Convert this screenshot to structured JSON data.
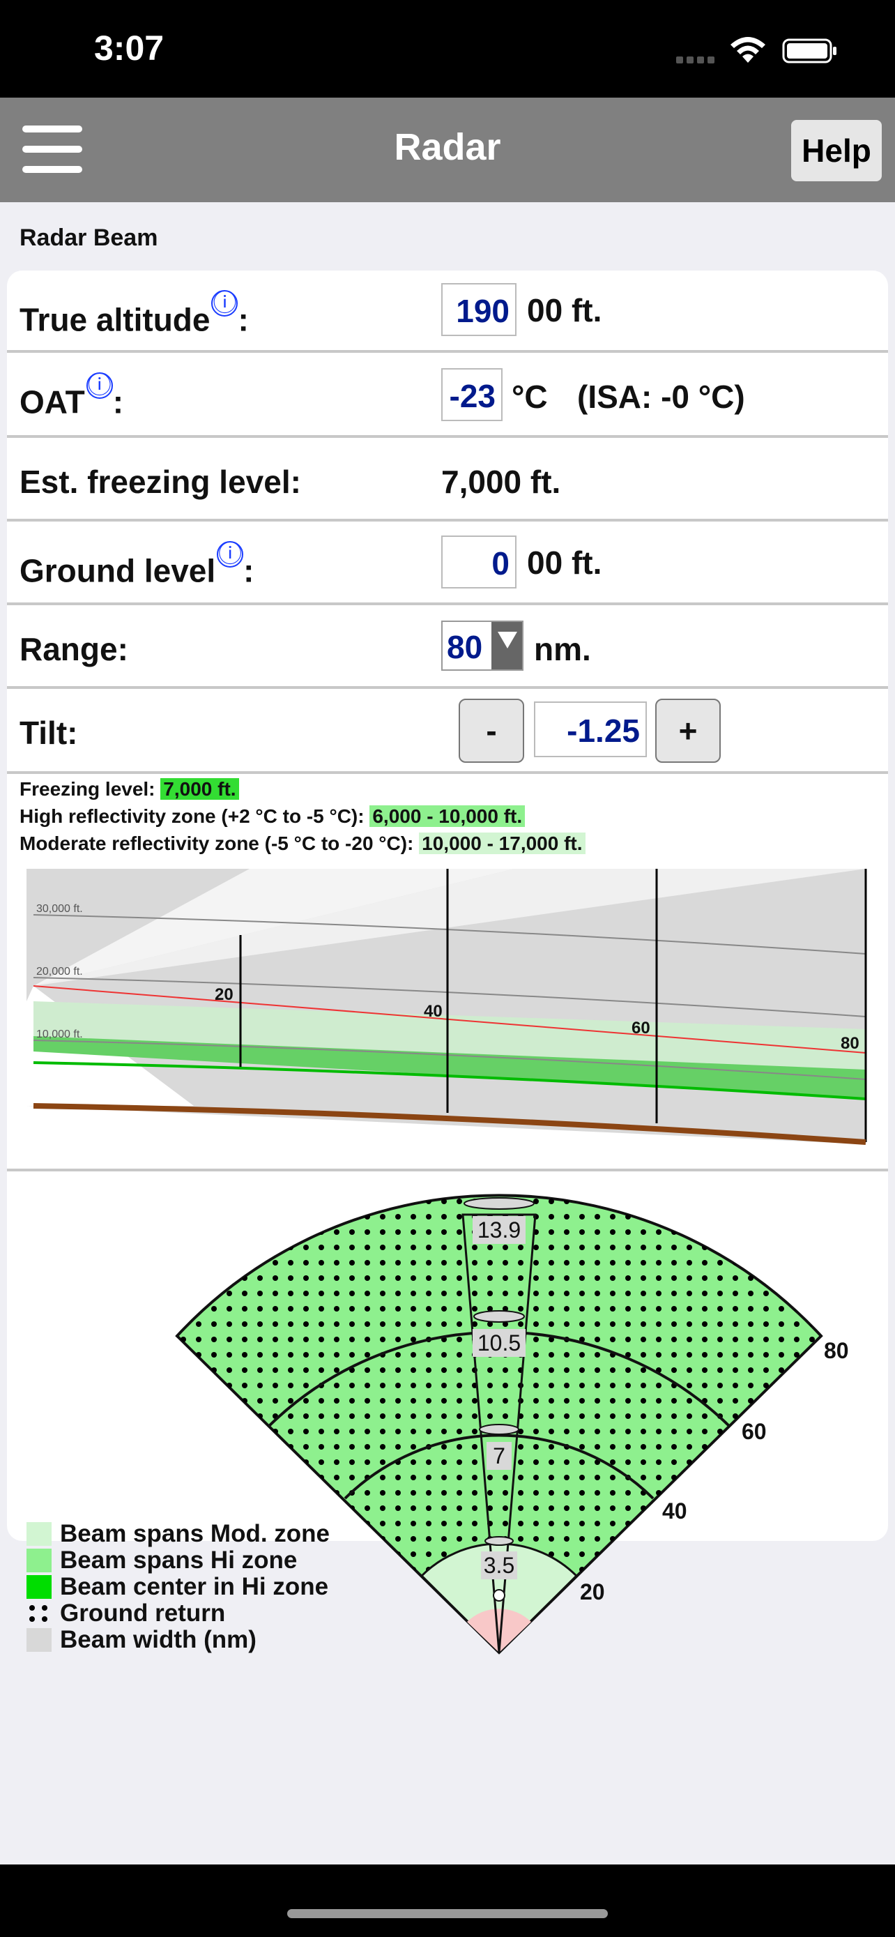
{
  "status": {
    "time": "3:07"
  },
  "nav": {
    "title": "Radar",
    "help_label": "Help"
  },
  "section": {
    "label": "Radar Beam"
  },
  "fields": {
    "true_altitude": {
      "label": "True altitude",
      "value": "190",
      "unit": "00 ft."
    },
    "oat": {
      "label": "OAT",
      "value": "-23",
      "unit": "°C",
      "isa": "(ISA: -0 °C)"
    },
    "est_freezing": {
      "label": "Est. freezing level:",
      "value": "7,000 ft."
    },
    "ground_level": {
      "label": "Ground level",
      "value": "0",
      "unit": "00 ft."
    },
    "range": {
      "label": "Range:",
      "value": "80",
      "unit": "nm."
    },
    "tilt": {
      "label": "Tilt:",
      "minus": "-",
      "value": "-1.25",
      "plus": "+"
    }
  },
  "info_icon": "ⓘ",
  "colon": ":",
  "zones": {
    "freezing_label": "Freezing level:",
    "freezing_value": "7,000 ft.",
    "hi_label": "High reflectivity zone (+2 °C to -5 °C):",
    "hi_value": "6,000 - 10,000 ft.",
    "mod_label": "Moderate reflectivity zone (-5 °C to -20 °C):",
    "mod_value": "10,000 - 17,000 ft."
  },
  "profile": {
    "alt_labels": [
      "30,000 ft.",
      "20,000 ft.",
      "10,000 ft."
    ],
    "range_labels": [
      "20",
      "40",
      "60",
      "80"
    ]
  },
  "sector": {
    "ring_labels": [
      "20",
      "40",
      "60",
      "80"
    ],
    "beam_widths": [
      "3.5",
      "7",
      "10.5",
      "13.9"
    ]
  },
  "legend": [
    {
      "label": "Beam spans Mod. zone",
      "color": "#d2f5d2"
    },
    {
      "label": "Beam spans Hi zone",
      "color": "#8ef08e"
    },
    {
      "label": "Beam center in Hi zone",
      "color": "#00dd00"
    },
    {
      "label": "Ground return",
      "color": "dots"
    },
    {
      "label": "Beam width (nm)",
      "color": "#d8d8d8"
    }
  ],
  "colors": {
    "navbar": "#808080",
    "input_text": "#001a8c",
    "hi_zone": "#00dd00",
    "ground": "#8b4513"
  }
}
